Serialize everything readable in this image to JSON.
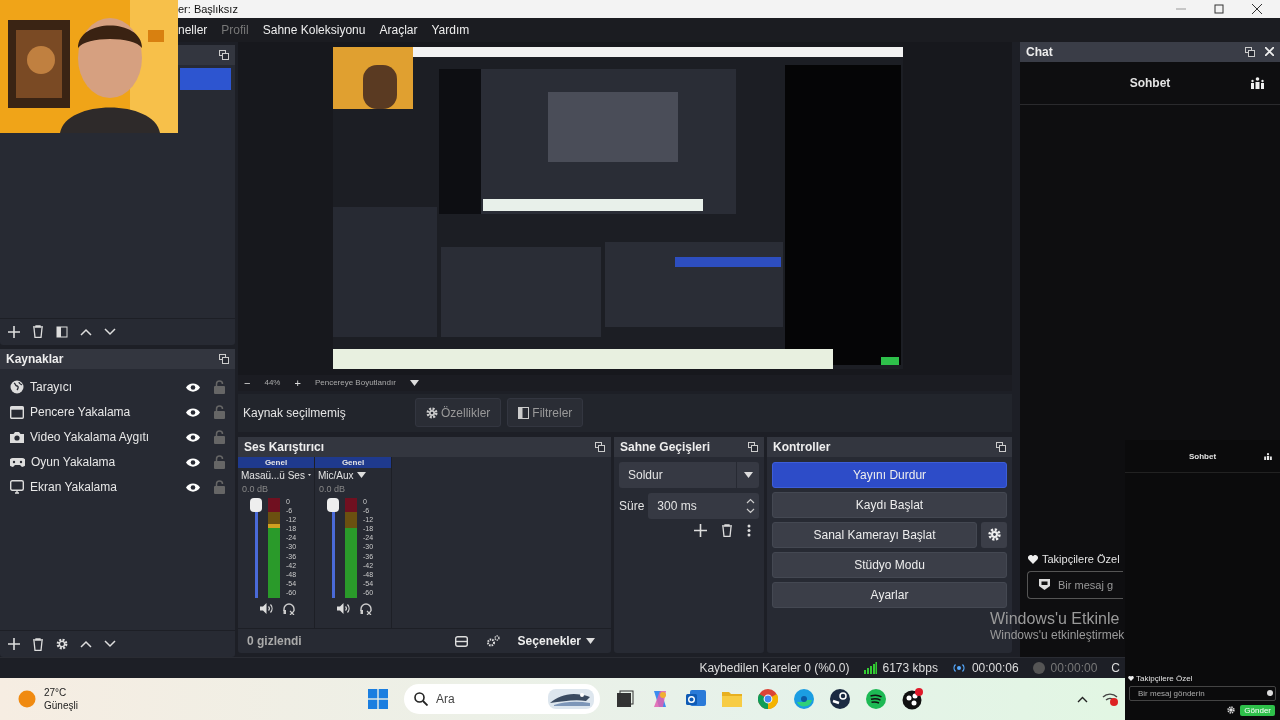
{
  "title_bar": {
    "title": "er: Başlıksız"
  },
  "menu": [
    {
      "label": "neller",
      "disabled": false
    },
    {
      "label": "Profil",
      "disabled": true
    },
    {
      "label": "Sahne Koleksiyonu",
      "disabled": false
    },
    {
      "label": "Araçlar",
      "disabled": false
    },
    {
      "label": "Yardım",
      "disabled": false
    }
  ],
  "scenes": {
    "items": [
      {
        "selected": true
      }
    ]
  },
  "zoom_bar": {
    "zoom_out": "−",
    "zoom": "44%",
    "zoom_in": "+",
    "fit": "Pencereye Boyutlandır"
  },
  "source_bar": {
    "status": "Kaynak seçilmemiş",
    "properties": "Özellikler",
    "filters": "Filtreler"
  },
  "sources": {
    "title": "Kaynaklar",
    "items": [
      {
        "label": "Tarayıcı",
        "kind": "browser",
        "visible": true,
        "locked": false
      },
      {
        "label": "Pencere Yakalama",
        "kind": "window",
        "visible": true,
        "locked": false
      },
      {
        "label": "Video Yakalama Aygıtı",
        "kind": "camera",
        "visible": true,
        "locked": false
      },
      {
        "label": "Oyun Yakalama",
        "kind": "game",
        "visible": true,
        "locked": false
      },
      {
        "label": "Ekran Yakalama",
        "kind": "display",
        "visible": true,
        "locked": false
      }
    ]
  },
  "mixer": {
    "title": "Ses Karıştırıcı",
    "channels": [
      {
        "tag": "Genel",
        "name": "Masaü...ü Ses",
        "volume": "0.0 dB",
        "fader": {
          "level": 1
        },
        "meter": {
          "level": 0.74
        },
        "muted": false,
        "scale": [
          "0",
          "-6",
          "-12",
          "-18",
          "-24",
          "-30",
          "-36",
          "-42",
          "-48",
          "-54",
          "-60"
        ]
      },
      {
        "tag": "Genel",
        "name": "Mic/Aux",
        "volume": "0.0 dB",
        "fader": {
          "level": 1
        },
        "meter": {
          "level": 0.7
        },
        "muted": false,
        "scale": [
          "0",
          "-6",
          "-12",
          "-18",
          "-24",
          "-30",
          "-36",
          "-42",
          "-48",
          "-54",
          "-60"
        ]
      }
    ],
    "hidden": "0 gizlendi",
    "options": "Seçenekler"
  },
  "transitions": {
    "title": "Sahne Geçişleri",
    "transition": "Soldur",
    "duration_label": "Süre",
    "duration": "300 ms"
  },
  "controls": {
    "title": "Kontroller",
    "buttons": [
      {
        "label": "Yayını Durdur",
        "active": true,
        "settings": false
      },
      {
        "label": "Kaydı Başlat",
        "active": false,
        "settings": false
      },
      {
        "label": "Sanal Kamerayı Başlat",
        "active": false,
        "settings": true
      },
      {
        "label": "Stüdyo Modu",
        "active": false,
        "settings": false
      },
      {
        "label": "Ayarlar",
        "active": false,
        "settings": false
      }
    ]
  },
  "chat_dock": {
    "title": "Chat",
    "header": "Sohbet",
    "followers_only": "Takipçilere Özel",
    "message_placeholder": "Bir mesaj g"
  },
  "activation_notice": {
    "title": "Windows'u Etkinle",
    "text": "Windows'u etkinleştirmek"
  },
  "status_bar": {
    "dropped_frames": "Kaybedilen Kareler 0 (%0.0)",
    "bitrate": "6173 kbps",
    "stream_time": "00:00:06",
    "record_time": "00:00:00",
    "cut": "C"
  },
  "chat_popout": {
    "header": "Sohbet",
    "followers_only": "Takipçilere Özel",
    "message_placeholder": "Bir mesaj gönderin",
    "send": "Gönder"
  },
  "taskbar": {
    "temperature": "27°C",
    "weather": "Güneşli",
    "search_placeholder": "Ara"
  }
}
